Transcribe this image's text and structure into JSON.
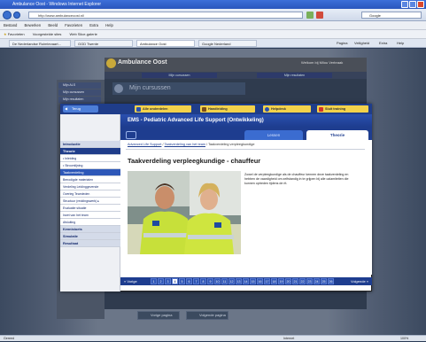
{
  "window": {
    "title": "Ambulance Oost - Windows Internet Explorer",
    "url": "http://www.ambulanceoost.nl/",
    "search_placeholder": "Google"
  },
  "menu": [
    "Bestand",
    "Bewerken",
    "Beeld",
    "Favorieten",
    "Extra",
    "Help"
  ],
  "favorites": [
    "Favorieten",
    "Voorgestelde sites",
    "Web Slice-galerie"
  ],
  "browser_tabs": [
    {
      "label": "De Nederlandse Ruimtevaart..."
    },
    {
      "label": "GGD Twente"
    },
    {
      "label": "Ambulance Oost",
      "active": true
    },
    {
      "label": "Google Nederland"
    }
  ],
  "toolbar_right": [
    "Pagina",
    "Veiligheid",
    "Extra",
    "Help"
  ],
  "site": {
    "title": "Ambulance Oost",
    "welcome": "Welkom bij Milou Verbraak",
    "bg_tabs": [
      "Mijn cursussen",
      "Mijn resultaten"
    ],
    "bg_side_items": [
      "Mijn ALS",
      "Mijn cursussen",
      "Mijn resultaten"
    ],
    "bg_section_title": "Mijn cursussen",
    "footer_buttons": [
      "Vorige pagina",
      "Volgende pagina"
    ]
  },
  "modal": {
    "back_label": "Terug",
    "top_buttons": [
      {
        "label": "Alle onderdelen",
        "icon": "list-icon"
      },
      {
        "label": "Handleiding",
        "icon": "book-icon"
      },
      {
        "label": "Helpdesk",
        "icon": "help-icon"
      },
      {
        "label": "Sluit training",
        "icon": "close-icon"
      }
    ],
    "course_title": "EMS - Pediatric Advanced Life Support (Ontwikkeling)",
    "sub_tabs": [
      "Lessen",
      "Theorie"
    ],
    "active_sub_tab": "Theorie",
    "nav": [
      {
        "label": "Introductie",
        "kind": "head"
      },
      {
        "label": "Theorie",
        "kind": "blue"
      },
      {
        "label": "• Inleiding",
        "kind": "sub"
      },
      {
        "label": "• Stroomlijning",
        "kind": "sub"
      },
      {
        "label": "Taakverdeling",
        "kind": "active"
      },
      {
        "label": "Benodigde materialen",
        "kind": "sub"
      },
      {
        "label": "Verdeling Leidinggevende",
        "kind": "sub"
      },
      {
        "label": "Overleg Teamleden",
        "kind": "sub"
      },
      {
        "label": "Structuur (reddingswerk) ▸",
        "kind": "sub"
      },
      {
        "label": "Evaluatie situatie",
        "kind": "sub"
      },
      {
        "label": "Inzet van het team",
        "kind": "sub"
      },
      {
        "label": "Afsluiting",
        "kind": "sub"
      },
      {
        "label": "Kennistoets",
        "kind": "head"
      },
      {
        "label": "Simulatie",
        "kind": "head"
      },
      {
        "label": "Resultaat",
        "kind": "head"
      }
    ],
    "breadcrumb": {
      "links": [
        "Advanced Life Support",
        "Taakverdeling van het team"
      ],
      "current": "Taakverdeling verpleegkundige"
    },
    "page_heading": "Taakverdeling verpleegkundige - chauffeur",
    "paragraph": "Zowel de verpleegkundige als de chauffeur kennen deze taakverdeling en hebben de vaardigheid om zelfstandig in te grijpen bij alle calamiteiten die kunnen optreden tijdens de rit.",
    "pager": {
      "prev": "« Vorige",
      "next": "Volgende »",
      "pages": [
        "1",
        "2",
        "3",
        "4",
        "5",
        "6",
        "7",
        "8",
        "9",
        "10",
        "11",
        "12",
        "13",
        "14",
        "15",
        "16",
        "17",
        "18",
        "19",
        "20",
        "21",
        "22",
        "23",
        "24",
        "25",
        "26"
      ],
      "current": "4"
    }
  },
  "status": {
    "left": "Gereed",
    "zone": "Internet",
    "zoom": "100%"
  }
}
